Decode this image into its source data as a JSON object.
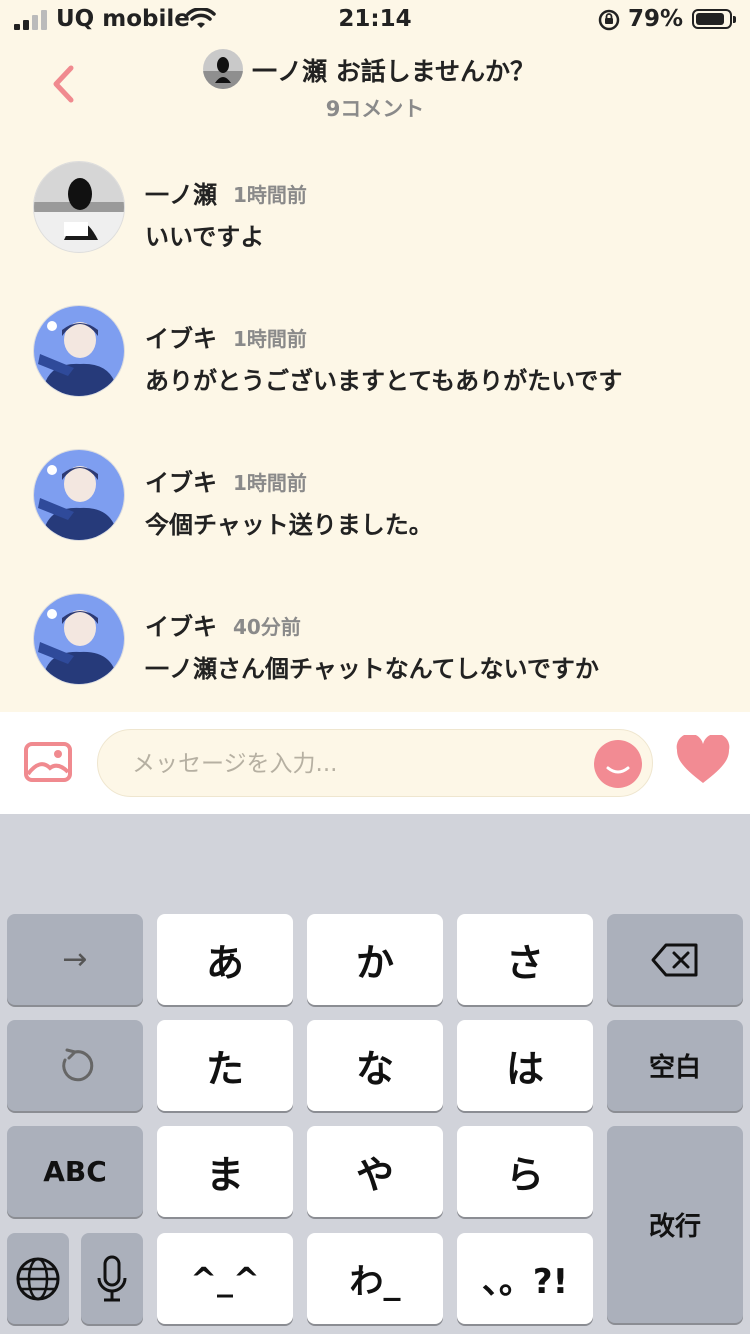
{
  "status_bar": {
    "carrier": "UQ mobile",
    "time": "21:14",
    "battery_percent": "79%",
    "battery_level": 0.79
  },
  "header": {
    "title": "一ノ瀬 お話しませんか？",
    "comment_count": "9コメント"
  },
  "comments": [
    {
      "name": "一ノ瀬",
      "time": "1時間前",
      "text": "いいですよ"
    },
    {
      "name": "イブキ",
      "time": "1時間前",
      "text": "ありがとうございますとてもありがたいです"
    },
    {
      "name": "イブキ",
      "time": "1時間前",
      "text": "今個チャット送りました。"
    },
    {
      "name": "イブキ",
      "time": "40分前",
      "text": "一ノ瀬さん個チャットなんてしないですか"
    }
  ],
  "input": {
    "placeholder": "メッセージを入力..."
  },
  "keyboard": {
    "row1": [
      "→",
      "あ",
      "か",
      "さ"
    ],
    "row2": [
      "た",
      "な",
      "は",
      "空白"
    ],
    "row3": [
      "ABC",
      "ま",
      "や",
      "ら",
      "改行"
    ],
    "row4": [
      "^_^",
      "わ_",
      "、。?!"
    ]
  },
  "colors": {
    "background": "#fdf7e7",
    "accent": "#f28b93",
    "key_white": "#ffffff",
    "key_gray": "#abb0bb",
    "keyboard_bg": "#d1d3da"
  }
}
